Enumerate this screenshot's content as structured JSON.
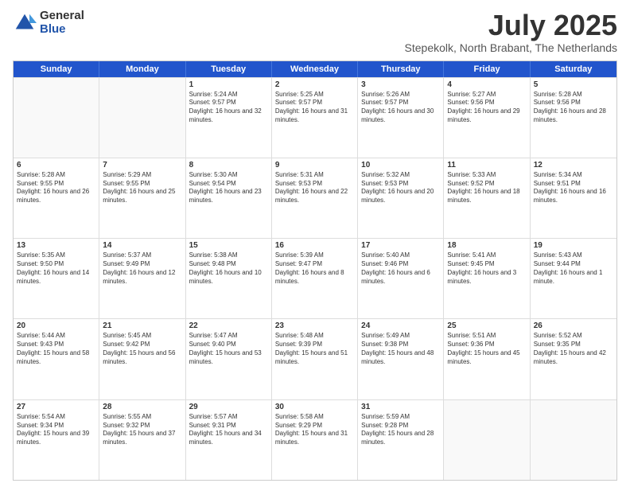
{
  "logo": {
    "general": "General",
    "blue": "Blue"
  },
  "title": {
    "month": "July 2025",
    "location": "Stepekolk, North Brabant, The Netherlands"
  },
  "header_days": [
    "Sunday",
    "Monday",
    "Tuesday",
    "Wednesday",
    "Thursday",
    "Friday",
    "Saturday"
  ],
  "weeks": [
    [
      {
        "day": "",
        "empty": true,
        "text": ""
      },
      {
        "day": "",
        "empty": true,
        "text": ""
      },
      {
        "day": "1",
        "text": "Sunrise: 5:24 AM\nSunset: 9:57 PM\nDaylight: 16 hours and 32 minutes."
      },
      {
        "day": "2",
        "text": "Sunrise: 5:25 AM\nSunset: 9:57 PM\nDaylight: 16 hours and 31 minutes."
      },
      {
        "day": "3",
        "text": "Sunrise: 5:26 AM\nSunset: 9:57 PM\nDaylight: 16 hours and 30 minutes."
      },
      {
        "day": "4",
        "text": "Sunrise: 5:27 AM\nSunset: 9:56 PM\nDaylight: 16 hours and 29 minutes."
      },
      {
        "day": "5",
        "text": "Sunrise: 5:28 AM\nSunset: 9:56 PM\nDaylight: 16 hours and 28 minutes."
      }
    ],
    [
      {
        "day": "6",
        "text": "Sunrise: 5:28 AM\nSunset: 9:55 PM\nDaylight: 16 hours and 26 minutes."
      },
      {
        "day": "7",
        "text": "Sunrise: 5:29 AM\nSunset: 9:55 PM\nDaylight: 16 hours and 25 minutes."
      },
      {
        "day": "8",
        "text": "Sunrise: 5:30 AM\nSunset: 9:54 PM\nDaylight: 16 hours and 23 minutes."
      },
      {
        "day": "9",
        "text": "Sunrise: 5:31 AM\nSunset: 9:53 PM\nDaylight: 16 hours and 22 minutes."
      },
      {
        "day": "10",
        "text": "Sunrise: 5:32 AM\nSunset: 9:53 PM\nDaylight: 16 hours and 20 minutes."
      },
      {
        "day": "11",
        "text": "Sunrise: 5:33 AM\nSunset: 9:52 PM\nDaylight: 16 hours and 18 minutes."
      },
      {
        "day": "12",
        "text": "Sunrise: 5:34 AM\nSunset: 9:51 PM\nDaylight: 16 hours and 16 minutes."
      }
    ],
    [
      {
        "day": "13",
        "text": "Sunrise: 5:35 AM\nSunset: 9:50 PM\nDaylight: 16 hours and 14 minutes."
      },
      {
        "day": "14",
        "text": "Sunrise: 5:37 AM\nSunset: 9:49 PM\nDaylight: 16 hours and 12 minutes."
      },
      {
        "day": "15",
        "text": "Sunrise: 5:38 AM\nSunset: 9:48 PM\nDaylight: 16 hours and 10 minutes."
      },
      {
        "day": "16",
        "text": "Sunrise: 5:39 AM\nSunset: 9:47 PM\nDaylight: 16 hours and 8 minutes."
      },
      {
        "day": "17",
        "text": "Sunrise: 5:40 AM\nSunset: 9:46 PM\nDaylight: 16 hours and 6 minutes."
      },
      {
        "day": "18",
        "text": "Sunrise: 5:41 AM\nSunset: 9:45 PM\nDaylight: 16 hours and 3 minutes."
      },
      {
        "day": "19",
        "text": "Sunrise: 5:43 AM\nSunset: 9:44 PM\nDaylight: 16 hours and 1 minute."
      }
    ],
    [
      {
        "day": "20",
        "text": "Sunrise: 5:44 AM\nSunset: 9:43 PM\nDaylight: 15 hours and 58 minutes."
      },
      {
        "day": "21",
        "text": "Sunrise: 5:45 AM\nSunset: 9:42 PM\nDaylight: 15 hours and 56 minutes."
      },
      {
        "day": "22",
        "text": "Sunrise: 5:47 AM\nSunset: 9:40 PM\nDaylight: 15 hours and 53 minutes."
      },
      {
        "day": "23",
        "text": "Sunrise: 5:48 AM\nSunset: 9:39 PM\nDaylight: 15 hours and 51 minutes."
      },
      {
        "day": "24",
        "text": "Sunrise: 5:49 AM\nSunset: 9:38 PM\nDaylight: 15 hours and 48 minutes."
      },
      {
        "day": "25",
        "text": "Sunrise: 5:51 AM\nSunset: 9:36 PM\nDaylight: 15 hours and 45 minutes."
      },
      {
        "day": "26",
        "text": "Sunrise: 5:52 AM\nSunset: 9:35 PM\nDaylight: 15 hours and 42 minutes."
      }
    ],
    [
      {
        "day": "27",
        "text": "Sunrise: 5:54 AM\nSunset: 9:34 PM\nDaylight: 15 hours and 39 minutes."
      },
      {
        "day": "28",
        "text": "Sunrise: 5:55 AM\nSunset: 9:32 PM\nDaylight: 15 hours and 37 minutes."
      },
      {
        "day": "29",
        "text": "Sunrise: 5:57 AM\nSunset: 9:31 PM\nDaylight: 15 hours and 34 minutes."
      },
      {
        "day": "30",
        "text": "Sunrise: 5:58 AM\nSunset: 9:29 PM\nDaylight: 15 hours and 31 minutes."
      },
      {
        "day": "31",
        "text": "Sunrise: 5:59 AM\nSunset: 9:28 PM\nDaylight: 15 hours and 28 minutes."
      },
      {
        "day": "",
        "empty": true,
        "text": ""
      },
      {
        "day": "",
        "empty": true,
        "text": ""
      }
    ]
  ]
}
